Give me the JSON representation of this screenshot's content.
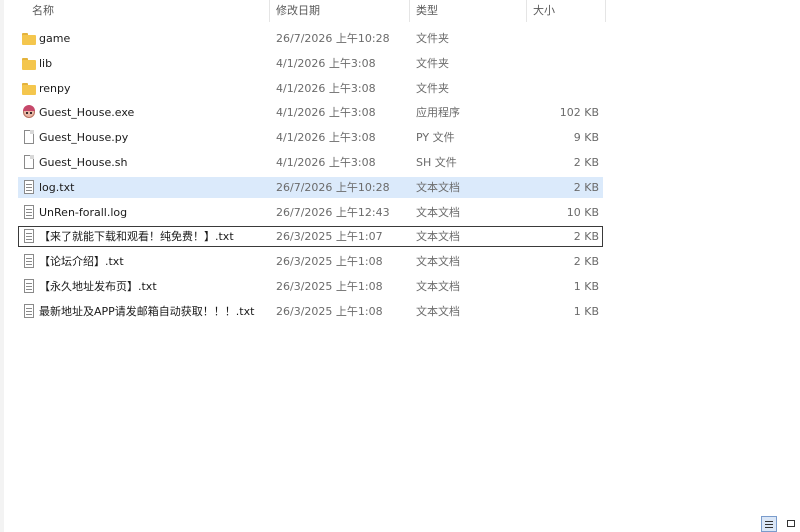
{
  "columns": {
    "name": "名称",
    "date": "修改日期",
    "type": "类型",
    "size": "大小"
  },
  "files": [
    {
      "name": "game",
      "date": "26/7/2026 上午10:28",
      "type": "文件夹",
      "size": "",
      "icon": "folder-icon"
    },
    {
      "name": "lib",
      "date": "4/1/2026 上午3:08",
      "type": "文件夹",
      "size": "",
      "icon": "folder-icon"
    },
    {
      "name": "renpy",
      "date": "4/1/2026 上午3:08",
      "type": "文件夹",
      "size": "",
      "icon": "folder-icon"
    },
    {
      "name": "Guest_House.exe",
      "date": "4/1/2026 上午3:08",
      "type": "应用程序",
      "size": "102 KB",
      "icon": "app-icon"
    },
    {
      "name": "Guest_House.py",
      "date": "4/1/2026 上午3:08",
      "type": "PY 文件",
      "size": "9 KB",
      "icon": "file-icon"
    },
    {
      "name": "Guest_House.sh",
      "date": "4/1/2026 上午3:08",
      "type": "SH 文件",
      "size": "2 KB",
      "icon": "file-icon"
    },
    {
      "name": "log.txt",
      "date": "26/7/2026 上午10:28",
      "type": "文本文档",
      "size": "2 KB",
      "icon": "text-file-icon"
    },
    {
      "name": "UnRen-forall.log",
      "date": "26/7/2026 上午12:43",
      "type": "文本文档",
      "size": "10 KB",
      "icon": "text-file-icon"
    },
    {
      "name": "【来了就能下载和观看！纯免费！】.txt",
      "date": "26/3/2025 上午1:07",
      "type": "文本文档",
      "size": "2 KB",
      "icon": "text-file-icon"
    },
    {
      "name": "【论坛介绍】.txt",
      "date": "26/3/2025 上午1:08",
      "type": "文本文档",
      "size": "2 KB",
      "icon": "text-file-icon"
    },
    {
      "name": "【永久地址发布页】.txt",
      "date": "26/3/2025 上午1:08",
      "type": "文本文档",
      "size": "1 KB",
      "icon": "text-file-icon"
    },
    {
      "name": "最新地址及APP请发邮箱自动获取！！！.txt",
      "date": "26/3/2025 上午1:08",
      "type": "文本文档",
      "size": "1 KB",
      "icon": "text-file-icon"
    }
  ],
  "selected_file": "log.txt",
  "focused_file": "【来了就能下载和观看！纯免费！】.txt",
  "view_buttons": [
    "details-view-icon",
    "large-icons-view-icon"
  ],
  "colors": {
    "selection": "#dbeafb",
    "folder": "#f4c64d",
    "focus_border": "#3a3a3a"
  }
}
